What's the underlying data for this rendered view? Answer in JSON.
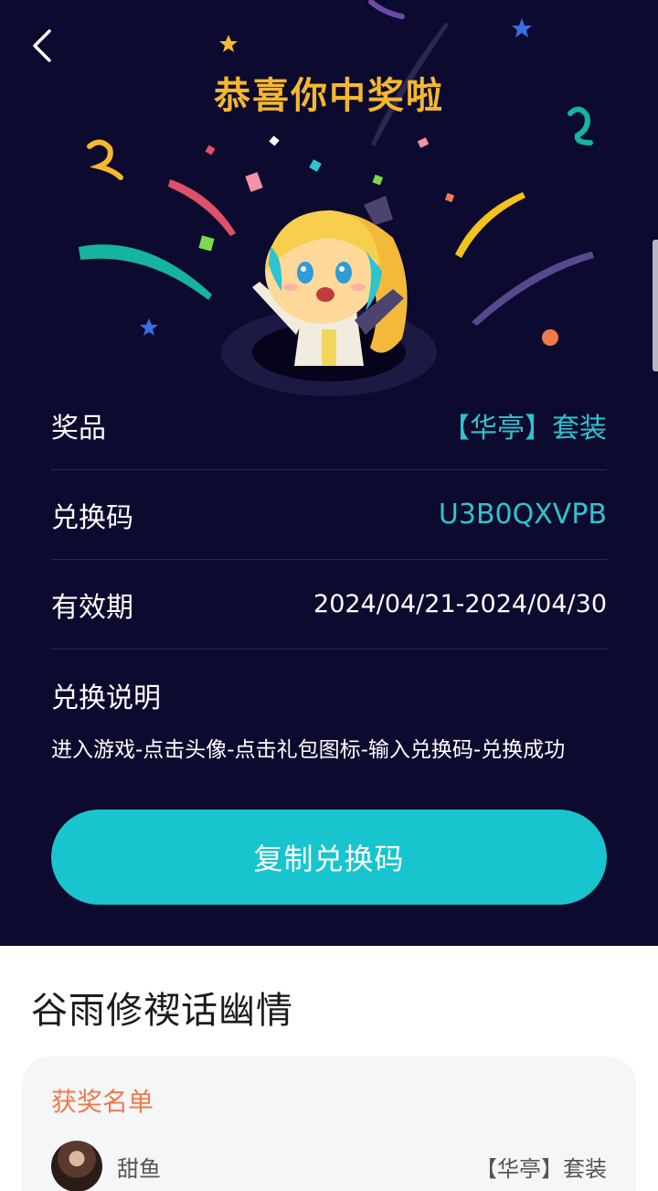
{
  "header": {
    "back_icon": "chevron-left-icon",
    "title": "恭喜你中奖啦"
  },
  "details": {
    "prize_label": "奖品",
    "prize_value": "【华亭】套装",
    "code_label": "兑换码",
    "code_value": "U3B0QXVPB",
    "validity_label": "有效期",
    "validity_value": "2024/04/21-2024/04/30",
    "redeem_label": "兑换说明",
    "redeem_steps": "进入游戏-点击头像-点击礼包图标-输入兑换码-兑换成功"
  },
  "copy_button": {
    "label": "复制兑换码"
  },
  "event": {
    "title": "谷雨修禊话幽情"
  },
  "winners": {
    "title": "获奖名单",
    "items": [
      {
        "name": "甜鱼",
        "prize": "【华亭】套装"
      }
    ]
  },
  "colors": {
    "hero_bg": "#0c0a2e",
    "title_gold": "#f5b82e",
    "accent_teal": "#18c4cd",
    "value_teal": "#2ec4cf",
    "winners_title": "#f0794a"
  }
}
